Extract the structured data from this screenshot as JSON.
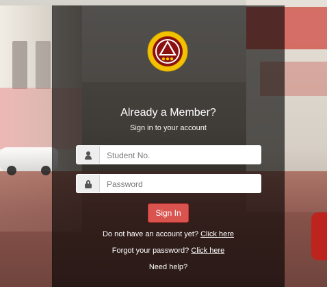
{
  "branding": {
    "seal_text": "TARLAC STATE UNIVERSITY",
    "seal_year": "1906"
  },
  "login": {
    "title": "Already a Member?",
    "subtitle": "Sign in to your account",
    "student_no": {
      "placeholder": "Student No.",
      "value": ""
    },
    "password": {
      "placeholder": "Password",
      "value": ""
    },
    "submit_label": "Sign In",
    "no_account_text": "Do not have an account yet?",
    "no_account_link": "Click here",
    "forgot_text": "Forgot your password?",
    "forgot_link": "Click here",
    "help_text": "Need help?"
  },
  "icons": {
    "user": "user-icon",
    "lock": "lock-icon"
  },
  "colors": {
    "panel": "#000000",
    "button": "#d9534f",
    "text": "#ffffff"
  }
}
